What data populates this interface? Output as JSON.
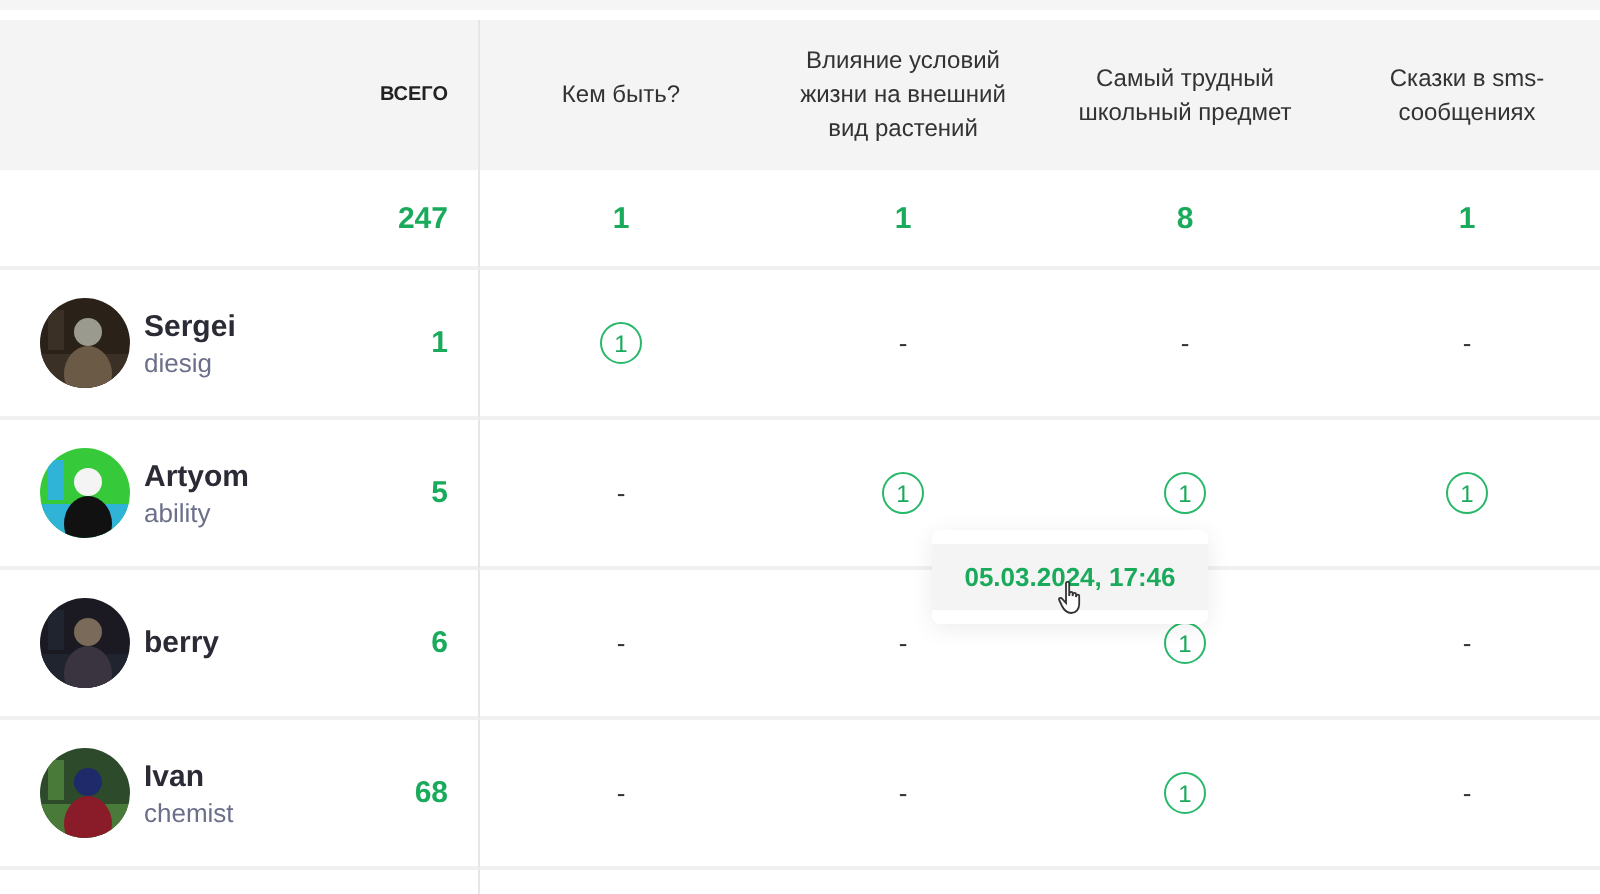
{
  "table": {
    "total_label": "ВСЕГО",
    "columns": [
      {
        "label": "Кем быть?"
      },
      {
        "label": "Влияние условий жизни на внешний вид растений"
      },
      {
        "label": "Самый трудный школьный предмет"
      },
      {
        "label": "Сказки в sms-сообщениях"
      }
    ],
    "grand_total": "247",
    "totals": [
      "1",
      "1",
      "8",
      "1"
    ],
    "rows": [
      {
        "name": "Sergei",
        "login": "diesig",
        "total": "1",
        "cells": [
          {
            "kind": "badge",
            "text": "1"
          },
          {
            "kind": "dash",
            "text": "-"
          },
          {
            "kind": "dash",
            "text": "-"
          },
          {
            "kind": "dash",
            "text": "-"
          }
        ]
      },
      {
        "name": "Artyom",
        "login": "ability",
        "total": "5",
        "cells": [
          {
            "kind": "dash",
            "text": "-"
          },
          {
            "kind": "badge",
            "text": "1"
          },
          {
            "kind": "badge",
            "text": "1"
          },
          {
            "kind": "badge",
            "text": "1"
          }
        ]
      },
      {
        "name": "berry",
        "total": "6",
        "cells": [
          {
            "kind": "dash",
            "text": "-"
          },
          {
            "kind": "dash",
            "text": "-"
          },
          {
            "kind": "badge",
            "text": "1"
          },
          {
            "kind": "dash",
            "text": "-"
          }
        ]
      },
      {
        "name": "Ivan",
        "login": "chemist",
        "total": "68",
        "cells": [
          {
            "kind": "dash",
            "text": "-"
          },
          {
            "kind": "dash",
            "text": "-"
          },
          {
            "kind": "badge",
            "text": "1"
          },
          {
            "kind": "dash",
            "text": "-"
          }
        ]
      }
    ]
  },
  "tooltip": {
    "text": "05.03.2024, 17:46"
  }
}
